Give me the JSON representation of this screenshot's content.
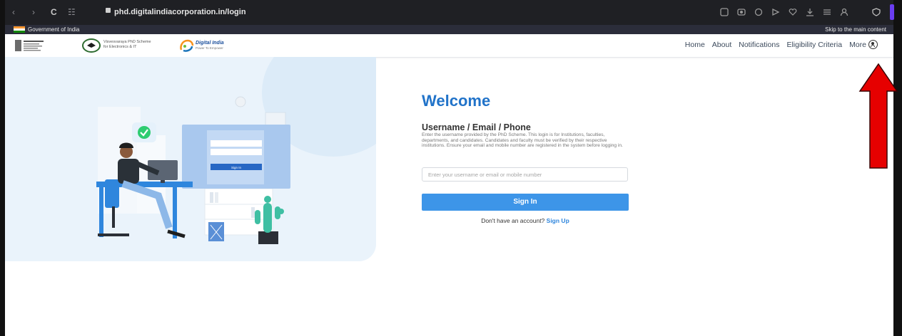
{
  "browser": {
    "url": "phd.digitalindiacorporation.in/login",
    "back_icon": "‹",
    "forward_icon": "›",
    "reload_icon": "C",
    "tune_icon": "☷"
  },
  "gov_strip": {
    "government_label": "Government of India",
    "skip_link": "Skip to the main content"
  },
  "header": {
    "meity_title": "Visvesvaraya PhD Scheme",
    "meity_subtitle": "for Electronics & IT",
    "digital_india_title": "Digital India",
    "digital_india_subtitle": "Power To Empower",
    "nav": [
      "Home",
      "About",
      "Notifications",
      "Eligibility Criteria",
      "More"
    ]
  },
  "illustration": {
    "screen_signin_label": "Sign In"
  },
  "login": {
    "welcome": "Welcome",
    "field_label": "Username / Email / Phone",
    "help_text": "Enter the username provided by the PhD Scheme. This login is for Institutions, faculties, departments, and candidates. Candidates and faculty must be verified by their respective institutions. Ensure your email and mobile number are registered in the system before logging in.",
    "input_placeholder": "Enter your username or email or mobile number",
    "signin_label": "Sign In",
    "signup_prompt": "Don't have an account?",
    "signup_link": "Sign Up"
  },
  "colors": {
    "accent": "#2173c9",
    "button": "#3d95e8",
    "annotation_arrow": "#e60000"
  }
}
